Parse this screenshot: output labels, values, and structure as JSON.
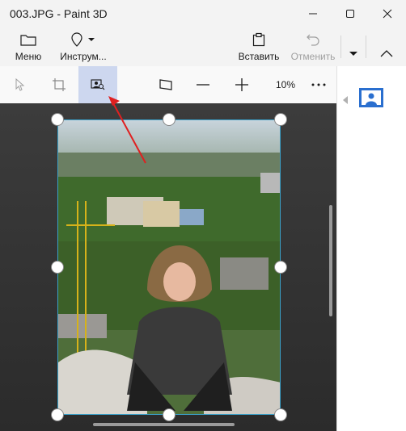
{
  "window": {
    "title": "003.JPG - Paint 3D",
    "minimize_icon": "minimize-icon",
    "maximize_icon": "maximize-icon",
    "close_icon": "close-icon"
  },
  "ribbon": {
    "menu_label": "Меню",
    "tools_label": "Инструм...",
    "paste_label": "Вставить",
    "undo_label": "Отменить",
    "undo_disabled": true
  },
  "toolbar": {
    "zoom": "10%",
    "active_tool": "magic-select"
  },
  "colors": {
    "accent": "#3aa0c8",
    "active_bg": "#cdd7ef",
    "arrow": "#e02020",
    "panel_icon": "#2a6fcf"
  }
}
